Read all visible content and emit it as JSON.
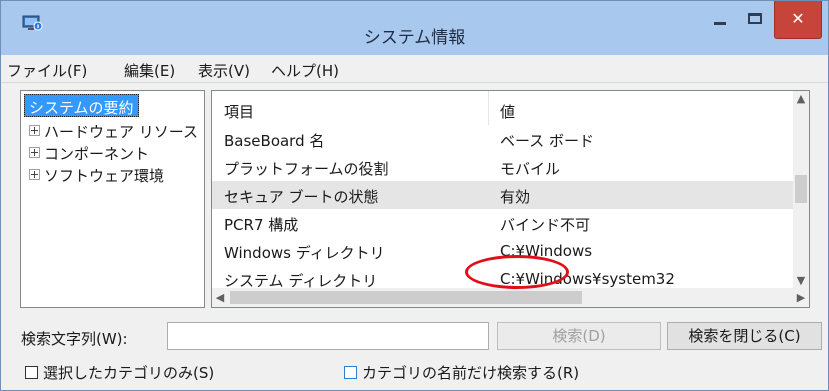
{
  "window": {
    "title": "システム情報"
  },
  "menu": [
    "ファイル(F)",
    "編集(E)",
    "表示(V)",
    "ヘルプ(H)"
  ],
  "tree": {
    "root": "システムの要約",
    "children": [
      "ハードウェア リソース",
      "コンポーネント",
      "ソフトウェア環境"
    ]
  },
  "details": {
    "headers": {
      "item": "項目",
      "value": "値"
    },
    "rows": [
      {
        "item": "BaseBoard 名",
        "value": "ベース ボード"
      },
      {
        "item": "プラットフォームの役割",
        "value": "モバイル"
      },
      {
        "item": "セキュア ブートの状態",
        "value": "有効"
      },
      {
        "item": "PCR7 構成",
        "value": "バインド不可"
      },
      {
        "item": "Windows ディレクトリ",
        "value": "C:¥Windows"
      },
      {
        "item": "システム ディレクトリ",
        "value": "C:¥Windows¥system32"
      }
    ],
    "selected_row": 2,
    "annotation_color": "#e0101a"
  },
  "search": {
    "label": "検索文字列(W):",
    "value": "",
    "search_button": "検索(D)",
    "close_button": "検索を閉じる(C)",
    "only_selected_category": "選択したカテゴリのみ(S)",
    "category_names_only": "カテゴリの名前だけ検索する(R)"
  },
  "icons": {
    "app": "system-info-icon",
    "minimize": "minimize-icon",
    "maximize": "maximize-icon",
    "close": "close-icon"
  }
}
